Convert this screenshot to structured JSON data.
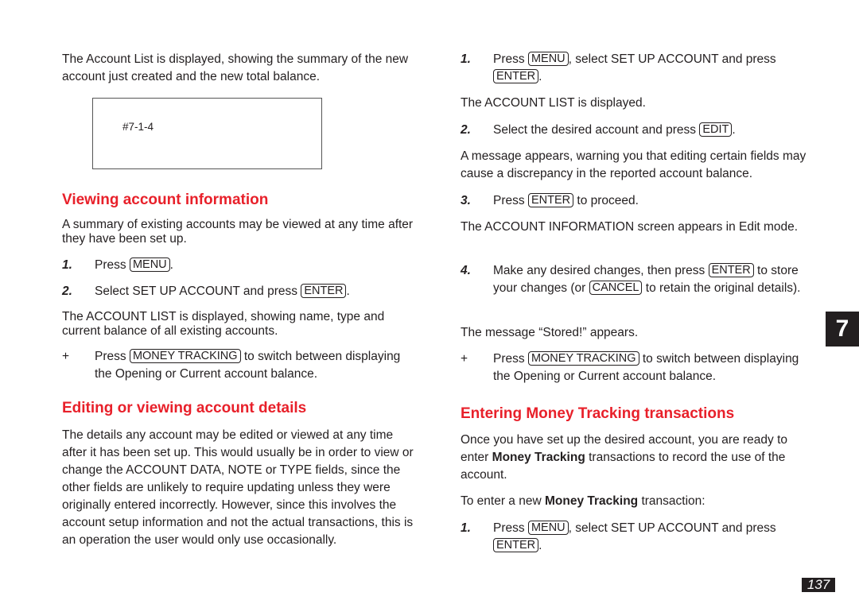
{
  "left": {
    "intro": "The Account List is displayed, showing the summary of the new account just created and the new total balance.",
    "screen_ref": "#7-1-4",
    "viewing": {
      "heading": "Viewing account information",
      "intro": "A summary of existing accounts may be viewed at any time after they have been set up.",
      "step1": {
        "num": "1.",
        "pre": "Press",
        "key": "MENU",
        "post": "."
      },
      "step2": {
        "num": "2.",
        "pre": "Select SET UP ACCOUNT and press",
        "key": "ENTER",
        "post": "."
      },
      "result": "The ACCOUNT LIST is displayed, showing name, type and current balance of all existing accounts.",
      "tip": {
        "symbol": "+",
        "pre": "Press",
        "key": "MONEY TRACKING",
        "post": "to switch between displaying the Opening or Current account balance."
      }
    },
    "editing": {
      "heading": "Editing or viewing account details",
      "body": "The details any account may be edited or viewed at any time after it has been set up. This would usually be in order to view or change the ACCOUNT DATA, NOTE or TYPE fields, since the other fields are unlikely to require updating unless they were originally entered incorrectly. However, since this involves the account setup information and not the actual transactions, this is an operation the user would only use occasionally."
    }
  },
  "right": {
    "step1": {
      "num": "1.",
      "pre": "Press",
      "key1": "MENU",
      "mid": ", select SET UP ACCOUNT and press",
      "key2": "ENTER",
      "post": "."
    },
    "result1": "The ACCOUNT LIST is displayed.",
    "step2": {
      "num": "2.",
      "pre": "Select the desired account and press",
      "key": "EDIT",
      "post": "."
    },
    "warning": "A message appears, warning you that editing certain fields may cause a discrepancy in the reported account balance.",
    "step3": {
      "num": "3.",
      "pre": "Press",
      "key": "ENTER",
      "post": "to proceed."
    },
    "result3": "The ACCOUNT INFORMATION screen appears in Edit mode.",
    "step4": {
      "num": "4.",
      "pre": "Make any desired changes, then press",
      "key1": "ENTER",
      "mid": "to store your changes (or",
      "key2": "CANCEL",
      "post": "to retain the original details)."
    },
    "stored": "The message “Stored!” appears.",
    "tip": {
      "symbol": "+",
      "pre": "Press",
      "key": "MONEY TRACKING",
      "post": "to switch between displaying the Opening or Current account balance."
    },
    "entering": {
      "heading": "Entering Money Tracking transactions",
      "intro_pre": "Once you have set up the desired account, you are ready to enter",
      "intro_bold": "Money Tracking",
      "intro_post": "transactions to record the use of the account.",
      "lead_pre": "To enter a new",
      "lead_bold": "Money Tracking",
      "lead_post": "transaction:",
      "step1": {
        "num": "1.",
        "pre": "Press",
        "key1": "MENU",
        "mid": ", select SET UP ACCOUNT and press",
        "key2": "ENTER",
        "post": "."
      }
    }
  },
  "chapter_tab": "7",
  "page_number": "137",
  "colors": {
    "heading": "#e8202a",
    "text": "#231f20",
    "tab_bg": "#231f20"
  }
}
